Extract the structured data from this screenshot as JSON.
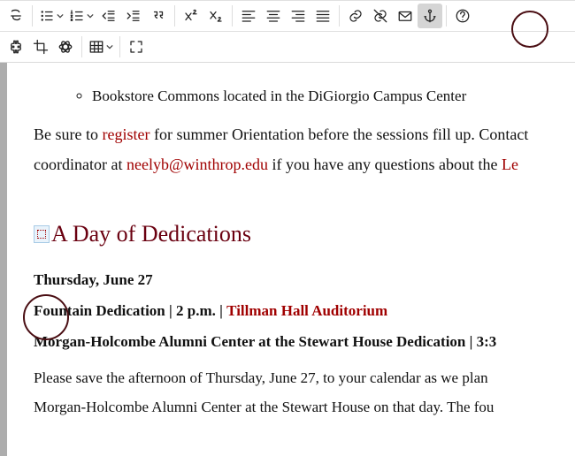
{
  "toolbar_icons": {
    "row1": [
      "strike",
      "bullets",
      "numbers",
      "outdent",
      "indent",
      "quote",
      "sup",
      "sub",
      "align-left",
      "align-center",
      "align-right",
      "align-justify",
      "link",
      "unlink",
      "mail",
      "anchor",
      "help"
    ],
    "row2": [
      "plugin",
      "crop",
      "atom",
      "table",
      "fullscreen"
    ]
  },
  "bullet": "Bookstore Commons located in the DiGiorgio Campus Center",
  "para1_a": "Be sure to ",
  "para1_link1": "register",
  "para1_b": " for summer Orientation before the sessions fill up. Contact",
  "para2_a": "coordinator at ",
  "para2_link2": "neelyb@winthrop.edu",
  "para2_b": " if you have any questions about the ",
  "para2_link3": "Le",
  "heading": "A Day of Dedications",
  "date_line": "Thursday, June 27",
  "event1_a": "Fountain Dedication ",
  "event1_pipe": "|",
  "event1_time": " 2 p.m. ",
  "event1_loc": "Tillman Hall Auditorium",
  "event2": "Morgan-Holcombe Alumni Center at the Stewart House Dedication | 3:3",
  "body_a": "Please save the afternoon of Thursday, June 27, to your calendar as we plan",
  "body_b": "Morgan-Holcombe Alumni Center at the Stewart House on that day. The fou"
}
